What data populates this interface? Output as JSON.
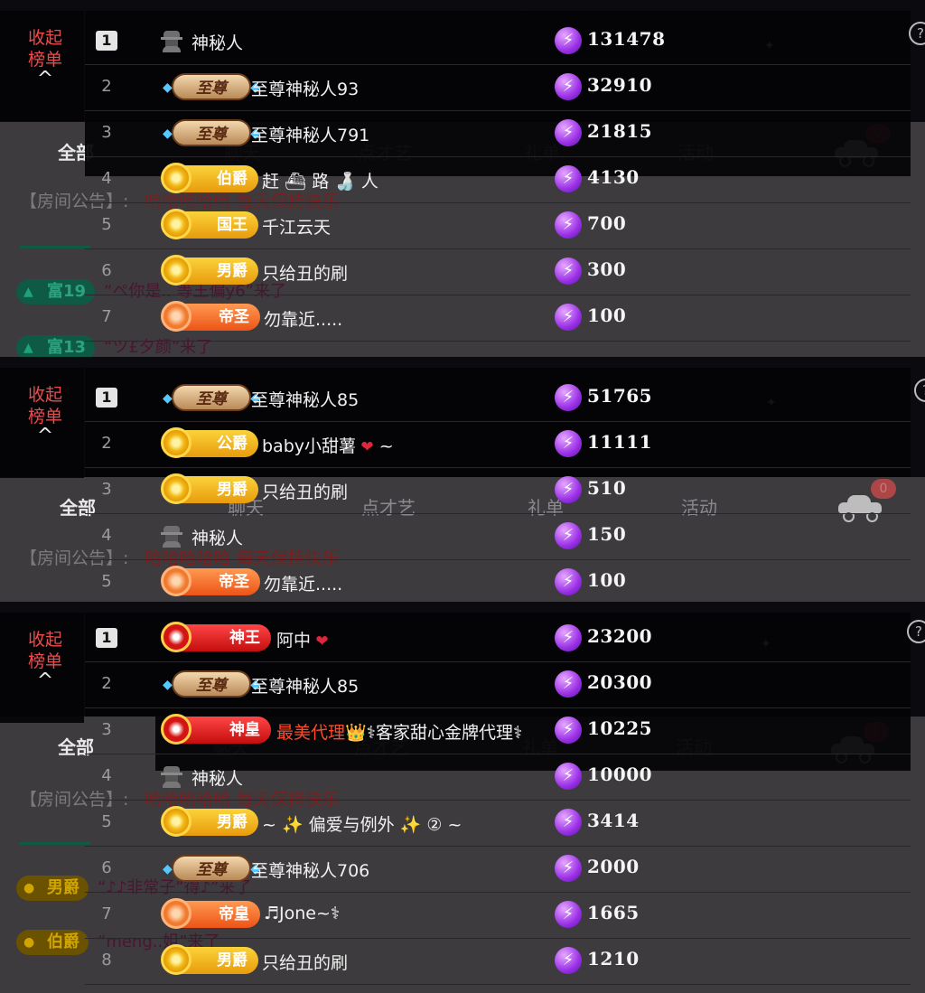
{
  "ui": {
    "collapse_label_1": "收起",
    "collapse_label_2": "榜单",
    "collapse_arrow": "^",
    "help": "?",
    "bolt_glyph": "⚡"
  },
  "room": {
    "tabs": [
      "全部",
      "聊天",
      "点才艺",
      "礼单",
      "活动"
    ],
    "announcement_label": "【房间公告】:",
    "announcement_text": "哈哈哈哈哈 每天保持快乐"
  },
  "panels": [
    {
      "car_count": "0",
      "chat": [
        {
          "badge": "富19",
          "text": "“ぺ你是.. 等王偏y6”来了"
        },
        {
          "badge": "富13",
          "text": "“ツ£夕颜”来了"
        }
      ],
      "rows": [
        {
          "rank": "1",
          "badge": "",
          "badge_kind": "anon",
          "name": "神秘人",
          "score": "131478"
        },
        {
          "rank": "2",
          "badge": "至尊",
          "badge_kind": "supreme",
          "name": "至尊神秘人93",
          "score": "32910"
        },
        {
          "rank": "3",
          "badge": "至尊",
          "badge_kind": "supreme",
          "name": "至尊神秘人791",
          "score": "21815"
        },
        {
          "rank": "4",
          "badge": "伯爵",
          "badge_kind": "gold",
          "name": "赶 ⛴ 路 🍶 人",
          "score": "4130"
        },
        {
          "rank": "5",
          "badge": "国王",
          "badge_kind": "gold",
          "name": "千江云天",
          "score": "700"
        },
        {
          "rank": "6",
          "badge": "男爵",
          "badge_kind": "gold",
          "name": "只给丑的刷",
          "score": "300"
        },
        {
          "rank": "7",
          "badge": "帝圣",
          "badge_kind": "orange",
          "name": "勿靠近.....",
          "score": "100"
        }
      ]
    },
    {
      "car_count": "0",
      "chat": [],
      "rows": [
        {
          "rank": "1",
          "badge": "至尊",
          "badge_kind": "supreme",
          "name": "至尊神秘人85",
          "score": "51765"
        },
        {
          "rank": "2",
          "badge": "公爵",
          "badge_kind": "gold",
          "name": "baby小甜薯",
          "name_extra": " ~",
          "heart": true,
          "score": "11111"
        },
        {
          "rank": "3",
          "badge": "男爵",
          "badge_kind": "gold",
          "name": "只给丑的刷",
          "score": "510"
        },
        {
          "rank": "4",
          "badge": "",
          "badge_kind": "anon",
          "name": "神秘人",
          "score": "150"
        },
        {
          "rank": "5",
          "badge": "帝圣",
          "badge_kind": "orange",
          "name": "勿靠近.....",
          "score": "100"
        }
      ]
    },
    {
      "car_count": "1",
      "chat": [
        {
          "badge": "男爵",
          "gold": true,
          "text": "“♪♪非常子”得♪”来了"
        },
        {
          "badge": "伯爵",
          "gold": true,
          "text": "“meng..姐”来了"
        }
      ],
      "rows": [
        {
          "rank": "1",
          "badge": "神王",
          "badge_kind": "red",
          "name": "阿中",
          "heart": true,
          "score": "23200"
        },
        {
          "rank": "2",
          "badge": "至尊",
          "badge_kind": "supreme",
          "name": "至尊神秘人85",
          "score": "20300"
        },
        {
          "rank": "3",
          "badge": "神皇",
          "badge_kind": "red",
          "name": "最美代理",
          "name_red": true,
          "name_extra": "👑⚕客家甜心金牌代理⚕",
          "score": "10225"
        },
        {
          "rank": "4",
          "badge": "",
          "badge_kind": "anon",
          "name": "神秘人",
          "score": "10000"
        },
        {
          "rank": "5",
          "badge": "男爵",
          "badge_kind": "gold",
          "name": "~ ✨ 偏爱与例外 ✨ ② ~",
          "score": "3414"
        },
        {
          "rank": "6",
          "badge": "至尊",
          "badge_kind": "supreme",
          "name": "至尊神秘人706",
          "score": "2000"
        },
        {
          "rank": "7",
          "badge": "帝皇",
          "badge_kind": "orange",
          "name": "♬Jone~⚕",
          "score": "1665"
        },
        {
          "rank": "8",
          "badge": "男爵",
          "badge_kind": "gold",
          "name": "只给丑的刷",
          "score": "1210"
        }
      ]
    }
  ]
}
